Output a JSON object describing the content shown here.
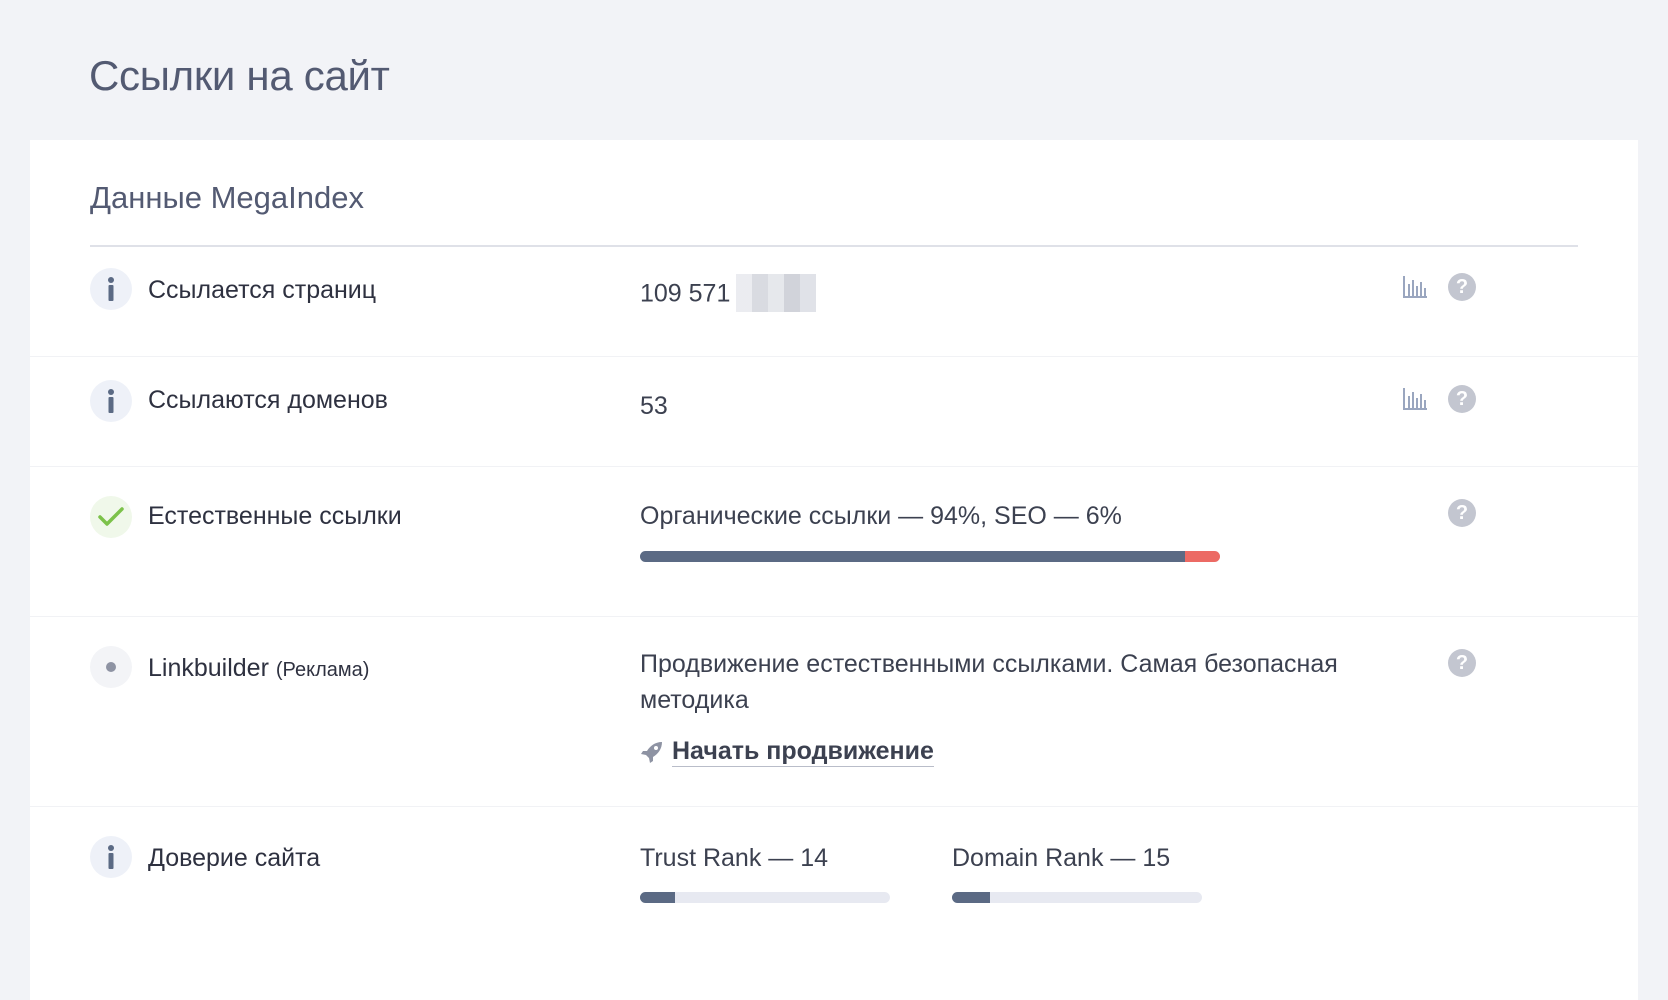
{
  "page": {
    "title": "Ссылки на сайт"
  },
  "card": {
    "title": "Данные MegaIndex"
  },
  "rows": {
    "pages": {
      "label": "Ссылается страниц",
      "value": "109 571"
    },
    "domains": {
      "label": "Ссылаются доменов",
      "value": "53"
    },
    "natural": {
      "label": "Естественные ссылки",
      "value": "Органические ссылки — 94%, SEO — 6%",
      "organic_percent": 94,
      "seo_percent": 6
    },
    "linkbuilder": {
      "label": "Linkbuilder",
      "sublabel": "(Реклама)",
      "description": "Продвижение естественными ссылками. Самая безопасная методика",
      "link_label": "Начать продвижение"
    },
    "trust": {
      "label": "Доверие сайта",
      "trust_rank_label": "Trust Rank — 14",
      "trust_rank": 14,
      "domain_rank_label": "Domain Rank — 15",
      "domain_rank": 15
    }
  },
  "icons": {
    "info": "info-icon",
    "check": "check-icon",
    "dot": "dot-icon",
    "chart": "bar-chart-icon",
    "help": "help-icon",
    "rocket": "rocket-icon"
  },
  "colors": {
    "accent": "#5b6a84",
    "seo": "#ec6a64",
    "ok": "#7cc24a",
    "muted": "#c3c6d0"
  }
}
